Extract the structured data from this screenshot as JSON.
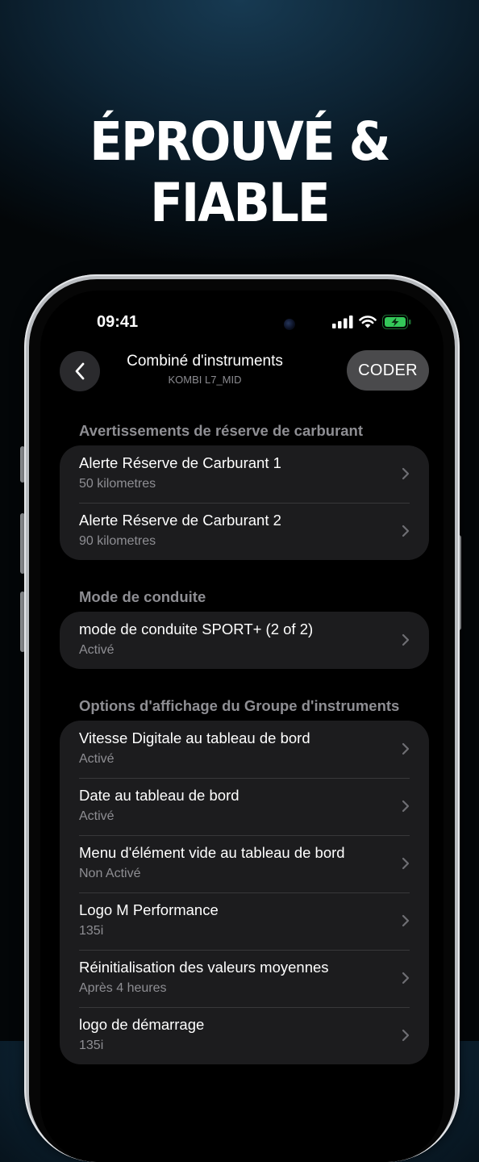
{
  "headline": "ÉPROUVÉ & FIABLE",
  "status_bar": {
    "time": "09:41",
    "icons": [
      "signal-icon",
      "wifi-icon",
      "battery-charging-icon"
    ],
    "battery_color": "#34c759"
  },
  "header": {
    "back_icon": "chevron-left-icon",
    "title": "Combiné d'instruments",
    "subtitle": "KOMBI L7_MID",
    "action_label": "CODER"
  },
  "sections": [
    {
      "title": "Avertissements de réserve de carburant",
      "items": [
        {
          "title": "Alerte Réserve de Carburant 1",
          "value": "50 kilometres"
        },
        {
          "title": "Alerte Réserve de Carburant 2",
          "value": "90 kilometres"
        }
      ]
    },
    {
      "title": "Mode de conduite",
      "items": [
        {
          "title": "mode de conduite SPORT+ (2 of 2)",
          "value": "Activé"
        }
      ]
    },
    {
      "title": "Options d'affichage du Groupe d'instruments",
      "items": [
        {
          "title": "Vitesse Digitale au tableau de bord",
          "value": "Activé"
        },
        {
          "title": "Date au tableau de bord",
          "value": "Activé"
        },
        {
          "title": "Menu d'élément vide au tableau de bord",
          "value": "Non Activé"
        },
        {
          "title": "Logo M Performance",
          "value": "135i"
        },
        {
          "title": "Réinitialisation des valeurs moyennes",
          "value": "Après 4 heures"
        },
        {
          "title": "logo de démarrage",
          "value": "135i"
        }
      ]
    }
  ]
}
